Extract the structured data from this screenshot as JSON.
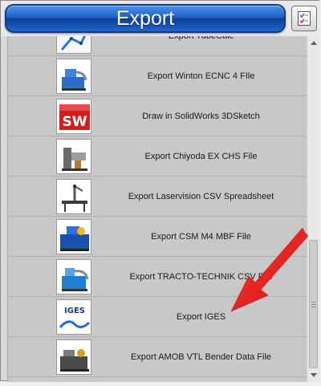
{
  "window": {
    "title": "Export"
  },
  "toolbar": {
    "checklist_icon": "checklist-icon"
  },
  "export_items": [
    {
      "label": "Export TubeCalc",
      "icon": "tubecalc-thumbnail"
    },
    {
      "label": "Export Winton ECNC 4 FIle",
      "icon": "winton-bender-thumbnail"
    },
    {
      "label": "Draw in SolidWorks 3DSketch",
      "icon": "solidworks-logo"
    },
    {
      "label": "Export Chiyoda EX CHS File",
      "icon": "chiyoda-machine-thumbnail"
    },
    {
      "label": "Export Laservision CSV Spreadsheet",
      "icon": "laservision-arm-thumbnail"
    },
    {
      "label": "Export CSM M4 MBF File",
      "icon": "csm-bender-thumbnail"
    },
    {
      "label": "Export TRACTO-TECHNIK CSV File",
      "icon": "tracto-technik-thumbnail"
    },
    {
      "label": "Export IGES",
      "icon": "iges-thumbnail",
      "thumb_text": "IGES"
    },
    {
      "label": "Export AMOB VTL Bender Data File",
      "icon": "amob-bender-thumbnail"
    }
  ],
  "colors": {
    "title_bar": "#1f62c8",
    "annotation_arrow": "#e01818",
    "row_background": "#c8c8c8"
  }
}
